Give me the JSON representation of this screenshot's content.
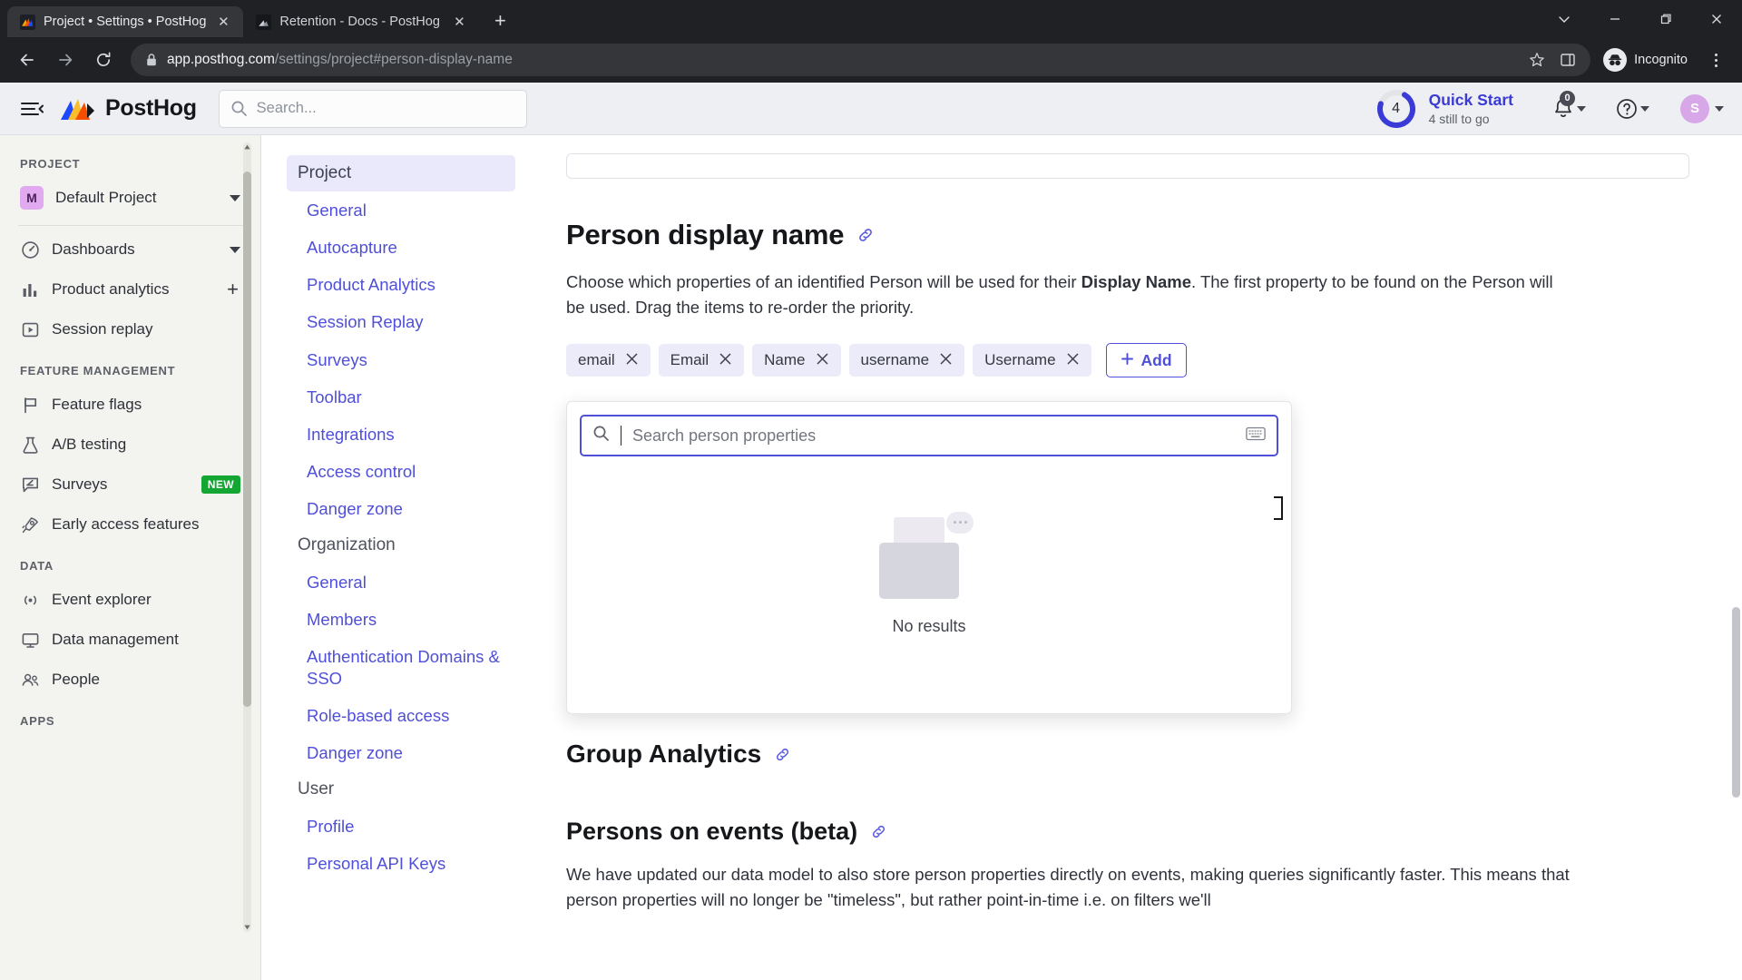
{
  "browser": {
    "tabs": [
      {
        "title": "Project • Settings • PostHog",
        "active": true,
        "close_label": "✕"
      },
      {
        "title": "Retention - Docs - PostHog",
        "active": false,
        "close_label": "✕"
      }
    ],
    "new_tab_label": "+",
    "window_controls": {
      "list_label": "⌄",
      "minimize": "—",
      "maximize": "❐",
      "close": "✕"
    },
    "nav": {
      "back": "back-arrow",
      "forward": "forward-arrow",
      "reload": "reload"
    },
    "address": {
      "host": "app.posthog.com",
      "path": "/settings/project#person-display-name",
      "lock": "lock-icon"
    },
    "profile_label": "Incognito",
    "bookmark_icon": "star-icon",
    "sidepanel_icon": "side-panel-icon",
    "menu_icon": "kebab-menu-icon"
  },
  "topbar": {
    "hamburger": "menu-icon",
    "brand": "PostHog",
    "search_placeholder": "Search...",
    "quick_start": {
      "count": "4",
      "title": "Quick Start",
      "subtitle": "4 still to go",
      "progress_pct": 20,
      "accent": "#3a3ad6"
    },
    "notifications_count": "0",
    "help_label": "?",
    "avatar_initial": "S"
  },
  "sidebar": {
    "sections": [
      {
        "label": "Project",
        "items": [
          {
            "label": "Default Project",
            "icon": "project-badge-icon",
            "badge_letter": "M",
            "trailing": "chevron-down-icon"
          }
        ]
      },
      {
        "label": "",
        "items": [
          {
            "label": "Dashboards",
            "icon": "dashboard-icon",
            "trailing": "chevron-down-icon"
          },
          {
            "label": "Product analytics",
            "icon": "bar-chart-icon",
            "trailing": "plus-icon"
          },
          {
            "label": "Session replay",
            "icon": "play-icon",
            "trailing": ""
          }
        ]
      },
      {
        "label": "Feature management",
        "items": [
          {
            "label": "Feature flags",
            "icon": "flag-icon",
            "trailing": ""
          },
          {
            "label": "A/B testing",
            "icon": "flask-icon",
            "trailing": ""
          },
          {
            "label": "Surveys",
            "icon": "survey-icon",
            "trailing": "",
            "badge": "NEW"
          },
          {
            "label": "Early access features",
            "icon": "rocket-icon",
            "trailing": ""
          }
        ]
      },
      {
        "label": "Data",
        "items": [
          {
            "label": "Event explorer",
            "icon": "signal-icon",
            "trailing": ""
          },
          {
            "label": "Data management",
            "icon": "monitor-icon",
            "trailing": ""
          },
          {
            "label": "People",
            "icon": "people-icon",
            "trailing": ""
          }
        ]
      },
      {
        "label": "Apps",
        "items": []
      }
    ]
  },
  "settings_nav": {
    "groups": [
      {
        "title": "Project",
        "active": true,
        "links": [
          "General",
          "Autocapture",
          "Product Analytics",
          "Session Replay",
          "Surveys",
          "Toolbar",
          "Integrations",
          "Access control",
          "Danger zone"
        ]
      },
      {
        "title": "Organization",
        "active": false,
        "links": [
          "General",
          "Members",
          "Authentication Domains & SSO",
          "Role-based access",
          "Danger zone"
        ]
      },
      {
        "title": "User",
        "active": false,
        "links": [
          "Profile",
          "Personal API Keys"
        ]
      }
    ]
  },
  "main": {
    "person_display_name": {
      "title": "Person display name",
      "anchor_icon": "link-icon",
      "description_part1": "Choose which properties of an identified Person will be used for their ",
      "description_bold": "Display Name",
      "description_part2": ". The first property to be found on the Person will be used. Drag the items to re-order the priority.",
      "tags": [
        "email",
        "Email",
        "Name",
        "username",
        "Username"
      ],
      "tag_remove_label": "✕",
      "add_button": "Add",
      "add_icon": "plus-icon"
    },
    "property_dropdown": {
      "search_placeholder": "Search person properties",
      "search_value": "",
      "search_icon": "search-icon",
      "keyboard_icon": "keyboard-icon",
      "empty_text": "No results",
      "empty_icon": "empty-box-icon"
    },
    "group_analytics": {
      "title": "Group Analytics",
      "anchor_icon": "link-icon"
    },
    "persons_on_events": {
      "title": "Persons on events (beta)",
      "anchor_icon": "link-icon",
      "paragraph": "We have updated our data model to also store person properties directly on events, making queries significantly faster. This means that person properties will no longer be \"timeless\", but rather point-in-time i.e. on filters we'll"
    }
  }
}
